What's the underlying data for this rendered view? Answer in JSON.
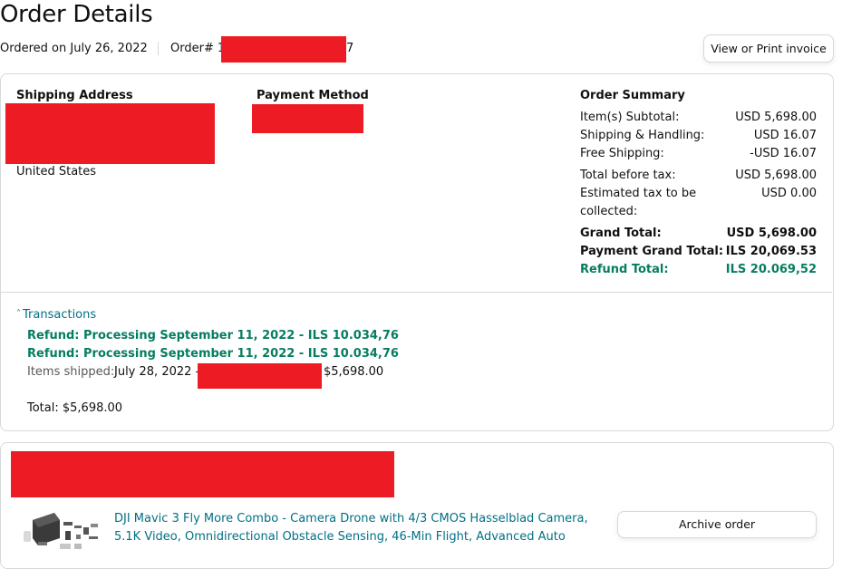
{
  "page": {
    "title": "Order Details",
    "ordered_on": "Ordered on July 26, 2022",
    "order_prefix": "Order# 1",
    "order_suffix": "7",
    "invoice_button": "View or Print invoice"
  },
  "details": {
    "shipping_header": "Shipping Address",
    "shipping_country": "United States",
    "payment_header": "Payment Method"
  },
  "summary": {
    "header": "Order Summary",
    "rows": [
      {
        "label": "Item(s) Subtotal:",
        "value": "USD 5,698.00"
      },
      {
        "label": "Shipping & Handling:",
        "value": "USD 16.07"
      },
      {
        "label": "Free Shipping:",
        "value": "-USD 16.07"
      },
      {
        "label": "Total before tax:",
        "value": "USD 5,698.00"
      },
      {
        "label": "Estimated tax to be",
        "label2": "collected:",
        "value": "USD 0.00"
      },
      {
        "label": "Grand Total:",
        "value": "USD 5,698.00"
      },
      {
        "label": "Payment Grand Total:",
        "value": "ILS 20,069.53"
      },
      {
        "label": "Refund Total:",
        "value": "ILS 20.069,52"
      }
    ]
  },
  "transactions": {
    "toggle_label": "Transactions",
    "refund_1": "Refund: Processing September 11, 2022 - ILS 10.034,76",
    "refund_2": "Refund: Processing September 11, 2022 - ILS 10.034,76",
    "shipped_label": "Items shipped:",
    "shipped_date": "July 28, 2022 -",
    "shipped_amount": "$5,698.00",
    "total": "Total: $5,698.00"
  },
  "item": {
    "title_line1": "DJI Mavic 3 Fly More Combo - Camera Drone with 4/3 CMOS Hasselblad Camera,",
    "title_line2": "5.1K Video, Omnidirectional Obstacle Sensing, 46-Min Flight, Advanced Auto",
    "archive_button": "Archive order"
  },
  "colors": {
    "redaction": "#ed1c24",
    "refund_green": "#067d62",
    "link_teal": "#007185",
    "border": "#d5d9d9"
  }
}
